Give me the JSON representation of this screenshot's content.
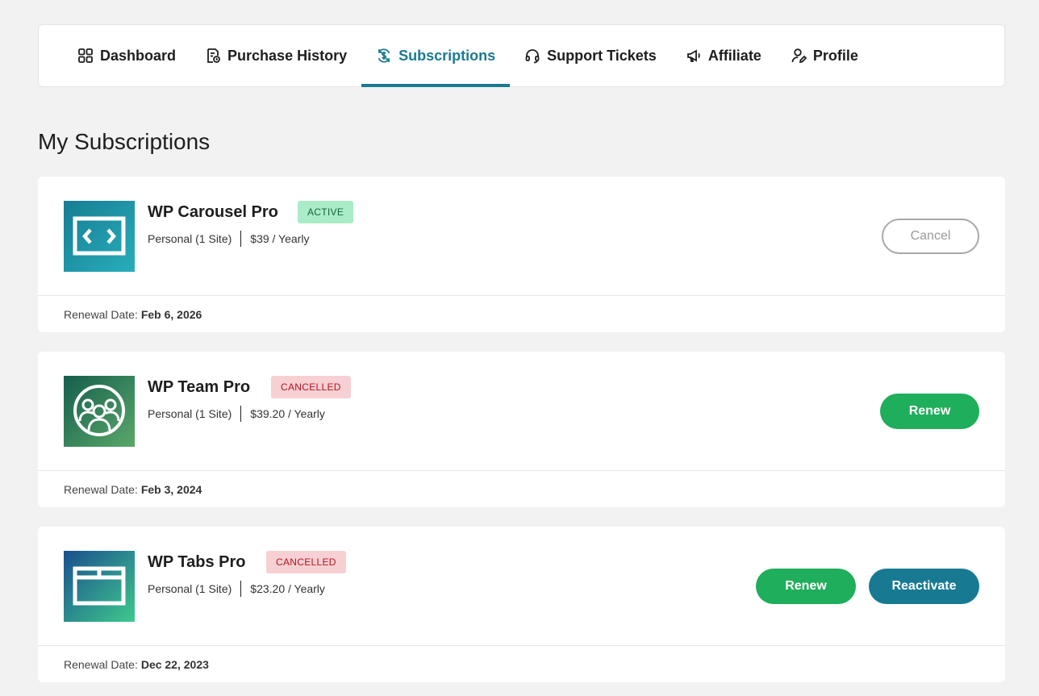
{
  "nav": {
    "tabs": [
      {
        "label": "Dashboard",
        "icon": "grid-icon"
      },
      {
        "label": "Purchase History",
        "icon": "receipt-icon"
      },
      {
        "label": "Subscriptions",
        "icon": "refresh-dollar-icon",
        "active": true
      },
      {
        "label": "Support Tickets",
        "icon": "headset-icon"
      },
      {
        "label": "Affiliate",
        "icon": "megaphone-icon"
      },
      {
        "label": "Profile",
        "icon": "user-edit-icon"
      }
    ]
  },
  "page": {
    "title": "My Subscriptions"
  },
  "subscriptions": [
    {
      "name": "WP Carousel Pro",
      "status": "ACTIVE",
      "plan": "Personal (1 Site)",
      "price": "$39 / Yearly",
      "renewal_label": "Renewal Date:",
      "renewal_date": "Feb 6, 2026",
      "actions": [
        "Cancel"
      ],
      "thumb_icon": "carousel-icon"
    },
    {
      "name": "WP Team Pro",
      "status": "CANCELLED",
      "plan": "Personal (1 Site)",
      "price": "$39.20 / Yearly",
      "renewal_label": "Renewal Date:",
      "renewal_date": "Feb 3, 2024",
      "actions": [
        "Renew"
      ],
      "thumb_icon": "team-icon"
    },
    {
      "name": "WP Tabs Pro",
      "status": "CANCELLED",
      "plan": "Personal (1 Site)",
      "price": "$23.20 / Yearly",
      "renewal_label": "Renewal Date:",
      "renewal_date": "Dec 22, 2023",
      "actions": [
        "Renew",
        "Reactivate"
      ],
      "thumb_icon": "tabs-icon"
    }
  ],
  "colors": {
    "accent": "#1a7a91",
    "renew": "#1fae5b",
    "reactivate": "#177a92",
    "active_badge_bg": "#a9ecc7",
    "cancelled_badge_bg": "#f7d0d4"
  }
}
